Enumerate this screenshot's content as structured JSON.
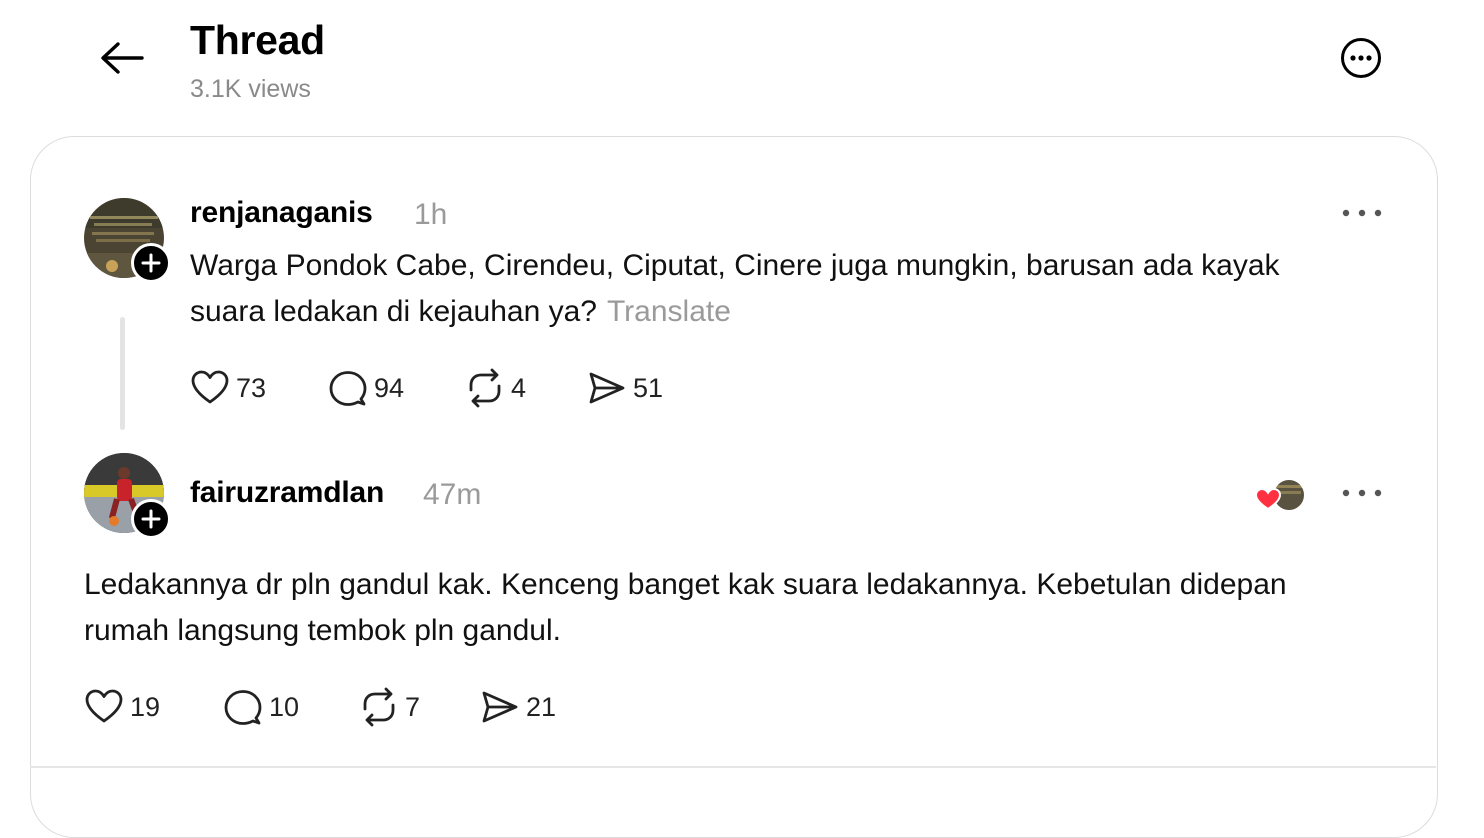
{
  "header": {
    "title": "Thread",
    "views": "3.1K views"
  },
  "posts": [
    {
      "username": "renjanaganis",
      "time": "1h",
      "text": "Warga Pondok Cabe, Cirendeu, Ciputat, Cinere juga mungkin, barusan ada kayak suara ledakan di kejauhan ya?",
      "translate_label": "Translate",
      "likes": "73",
      "replies": "94",
      "reposts": "4",
      "shares": "51"
    },
    {
      "username": "fairuzramdlan",
      "time": "47m",
      "text": "Ledakannya dr pln gandul kak. Kenceng banget kak suara ledakannya. Kebetulan didepan rumah langsung tembok pln gandul.",
      "likes": "19",
      "replies": "10",
      "reposts": "7",
      "shares": "21"
    }
  ],
  "icons": {
    "back": "arrow-left-icon",
    "more": "more-circle-icon",
    "post_more": "ellipsis-icon",
    "like": "heart-icon",
    "reply": "comment-icon",
    "repost": "repost-icon",
    "share": "send-icon",
    "follow": "plus-icon",
    "liked": "red-heart-icon"
  },
  "colors": {
    "text": "#000000",
    "muted": "#9a9a9a",
    "border": "#dcdcdc",
    "liked_heart": "#ff3040"
  }
}
